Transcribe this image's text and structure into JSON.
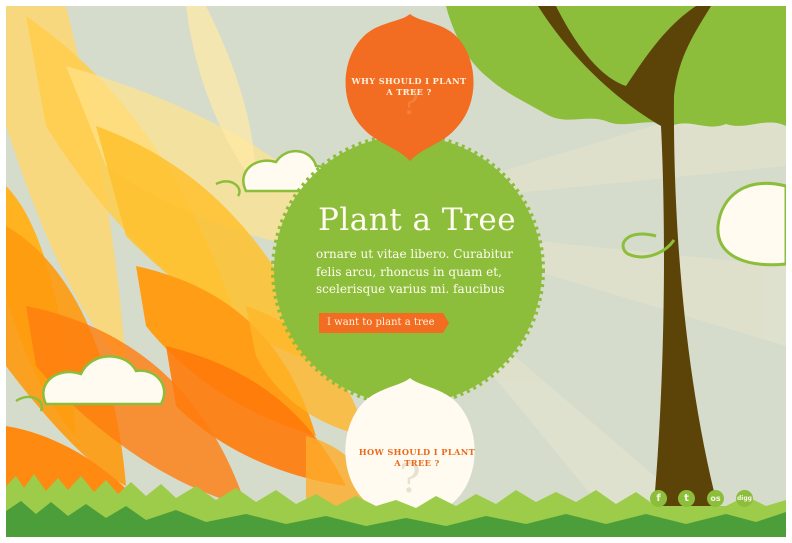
{
  "hero": {
    "title": "Plant a Tree",
    "text": "ornare ut vitae libero. Curabitur felis arcu, rhoncus in quam et, scelerisque varius mi. faucibus",
    "cta_label": "I want to plant a tree"
  },
  "why_bubble": {
    "label": "WHY SHOULD I PLANT A TREE ?"
  },
  "how_bubble": {
    "label": "HOW SHOULD I PLANT A TREE ?"
  },
  "social": [
    {
      "icon": "facebook-icon",
      "glyph": "f"
    },
    {
      "icon": "twitter-icon",
      "glyph": "t"
    },
    {
      "icon": "lastfm-icon",
      "glyph": "os"
    },
    {
      "icon": "digg-icon",
      "glyph": "digg"
    }
  ],
  "colors": {
    "orange": "#f26c21",
    "green": "#8cbd3b",
    "trunk": "#5c4308",
    "cream": "#fffbf0",
    "sky": "#d5dccb"
  }
}
